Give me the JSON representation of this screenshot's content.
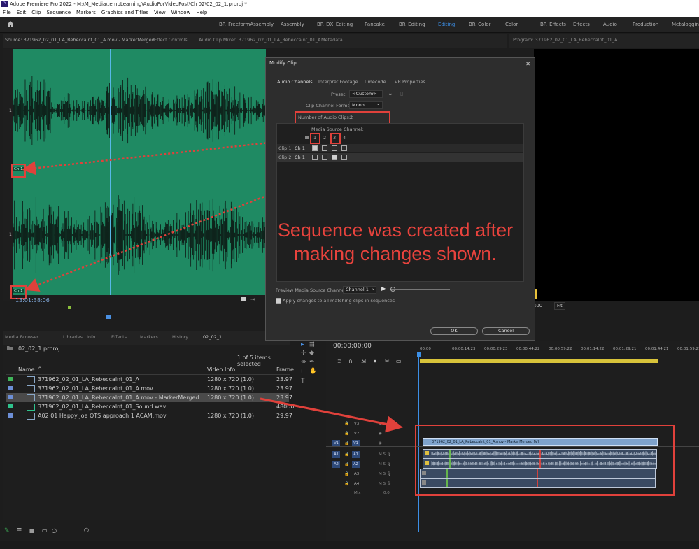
{
  "window": {
    "title": "Adobe Premiere Pro 2022 - M:\\M_Media\\tempLearning\\AudioForVideoPost\\Ch 02\\02_02_1.prproj *",
    "app_badge": "Pr"
  },
  "menu": [
    "File",
    "Edit",
    "Clip",
    "Sequence",
    "Markers",
    "Graphics and Titles",
    "View",
    "Window",
    "Help"
  ],
  "workspaces": [
    {
      "label": "BR_FreeformAssembly",
      "active": false
    },
    {
      "label": "Assembly",
      "active": false
    },
    {
      "label": "BR_DX_Editing",
      "active": false
    },
    {
      "label": "Pancake",
      "active": false
    },
    {
      "label": "BR_Editing",
      "active": false
    },
    {
      "label": "Editing",
      "active": true
    },
    {
      "label": "BR_Color",
      "active": false
    },
    {
      "label": "Color",
      "active": false
    },
    {
      "label": "BR_Effects",
      "active": false
    },
    {
      "label": "Effects",
      "active": false
    },
    {
      "label": "Audio",
      "active": false
    },
    {
      "label": "Production",
      "active": false
    },
    {
      "label": "Metalogging",
      "active": false
    }
  ],
  "source_panel": {
    "tabs": [
      "Source: 371962_02_01_LA_Rebeccalnt_01_A.mov - MarkerMerged",
      "Effect Controls",
      "Audio Clip Mixer: 371962_02_01_LA_Rebeccalnt_01_A",
      "Metadata"
    ],
    "channel_label_1": "1",
    "channel_label_2": "1",
    "ch_badge_1": "Ch 1",
    "ch_badge_2": "Ch 1",
    "timecode": "13:01:38:06"
  },
  "program_panel": {
    "tab": "Program: 371962_02_01_LA_Rebeccalnt_01_A",
    "timecode_partial": ":00",
    "fit": "Fit"
  },
  "dialog": {
    "title": "Modify Clip",
    "close": "✕",
    "tabs": [
      {
        "label": "Audio Channels",
        "active": true
      },
      {
        "label": "Interpret Footage",
        "active": false
      },
      {
        "label": "Timecode",
        "active": false
      },
      {
        "label": "VR Properties",
        "active": false
      }
    ],
    "preset_label": "Preset:",
    "preset_value": "<Custom>",
    "format_label": "Clip Channel Format:",
    "format_value": "Mono",
    "num_clips_label": "Number of Audio Clips:",
    "num_clips_value": "2",
    "media_source_label": "Media Source Channel:",
    "channel_numbers": [
      "1",
      "2",
      "3",
      "4"
    ],
    "rows": [
      {
        "clip": "Clip 1",
        "ch": "Ch 1",
        "checks": [
          true,
          false,
          false,
          false
        ]
      },
      {
        "clip": "Clip 2",
        "ch": "Ch 1",
        "checks": [
          false,
          false,
          true,
          false
        ]
      }
    ],
    "preview_label": "Preview Media Source Channel:",
    "preview_value": "Channel 1",
    "apply_label": "Apply changes to all matching clips in sequences",
    "ok": "OK",
    "cancel": "Cancel"
  },
  "annotation": {
    "text_line1": "Sequence was created after",
    "text_line2": "making changes shown."
  },
  "project_panel": {
    "tabs": [
      "Media Browser",
      "Libraries",
      "Info",
      "Effects",
      "Markers",
      "History",
      "02_02_1"
    ],
    "project_name": "02_02_1.prproj",
    "selection_status": "1 of 5 items selected",
    "col_name": "Name",
    "col_video": "Video Info",
    "col_frame": "Frame",
    "items": [
      {
        "name": "371962_02_01_LA_Rebeccalnt_01_A",
        "video": "1280 x 720 (1.0)",
        "frame": "23.97",
        "color": "#3fb55a",
        "selected": false
      },
      {
        "name": "371962_02_01_LA_Rebeccalnt_01_A.mov",
        "video": "1280 x 720 (1.0)",
        "frame": "23.97",
        "color": "#6d8fd6",
        "selected": false
      },
      {
        "name": "371962_02_01_LA_Rebeccalnt_01_A.mov - MarkerMerged",
        "video": "1280 x 720 (1.0)",
        "frame": "23.97",
        "color": "#6d8fd6",
        "selected": true
      },
      {
        "name": "371962_02_01_LA_Rebeccalnt_01_Sound.wav",
        "video": "",
        "frame": "48000",
        "color": "#2ec28c",
        "selected": false
      },
      {
        "name": "A02 01 Happy Joe OTS approach 1 ACAM.mov",
        "video": "1280 x 720 (1.0)",
        "frame": "29.97",
        "color": "#6d8fd6",
        "selected": false
      }
    ]
  },
  "timeline": {
    "timecode": "00:00:00:00",
    "ruler": [
      "00:00",
      "00:00:14:23",
      "00:00:29:23",
      "00:00:44:22",
      "00:00:59:22",
      "00:01:14:22",
      "00:01:29:21",
      "00:01:44:21",
      "00:01:59:21"
    ],
    "tracks_video": [
      "V3",
      "V2",
      "V1"
    ],
    "tracks_audio": [
      "A1",
      "A2",
      "A3",
      "A4"
    ],
    "mix": "Mix",
    "mix_value": "0.0",
    "video_clip_label": "371962_02_01_LA_Rebeccalnt_01_A.mov - MarkerMerged [V]",
    "src_v1": "V1",
    "src_a1": "A1",
    "src_a2": "A2"
  }
}
